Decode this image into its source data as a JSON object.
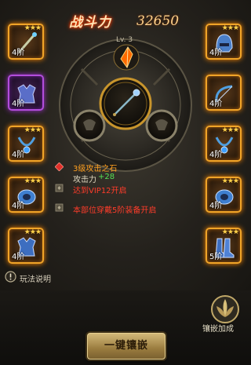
{
  "header": {
    "power_label": "战斗力",
    "power_value": "32650"
  },
  "equipment_left": [
    {
      "grade": "4阶",
      "stars": "★★★",
      "frame": "gold",
      "item": "staff"
    },
    {
      "grade": "4阶",
      "stars": "",
      "frame": "purple",
      "item": "armor"
    },
    {
      "grade": "4阶",
      "stars": "★★★",
      "frame": "gold",
      "item": "necklace"
    },
    {
      "grade": "4阶",
      "stars": "★★★",
      "frame": "gold",
      "item": "bracer"
    },
    {
      "grade": "4阶",
      "stars": "★★★",
      "frame": "gold",
      "item": "armor"
    }
  ],
  "equipment_right": [
    {
      "grade": "4阶",
      "stars": "★★★",
      "frame": "gold",
      "item": "helmet"
    },
    {
      "grade": "4阶",
      "stars": "",
      "frame": "gold",
      "item": "bow"
    },
    {
      "grade": "4阶",
      "stars": "★★★",
      "frame": "gold",
      "item": "necklace"
    },
    {
      "grade": "4阶",
      "stars": "★★★",
      "frame": "gold",
      "item": "bracer"
    },
    {
      "grade": "5阶",
      "stars": "★★★",
      "frame": "gold",
      "item": "boots"
    }
  ],
  "center": {
    "level": "Lv. 3"
  },
  "gem_info": {
    "name": "3级攻击之石",
    "stat_label": "攻击力",
    "stat_value": "+28",
    "slot2_text": "达到VIP12开启",
    "slot3_text": "本部位穿戴5阶装备开启"
  },
  "help": {
    "label": "玩法说明"
  },
  "actions": {
    "one_click_label": "一键镶嵌",
    "inlay_bonus_label": "镶嵌加成"
  },
  "colors": {
    "gold_frame": "#f0a428",
    "purple_frame": "#b24ddc",
    "red_text": "#ff3c2a",
    "green_text": "#55e055",
    "gem_name": "#ffa020"
  }
}
